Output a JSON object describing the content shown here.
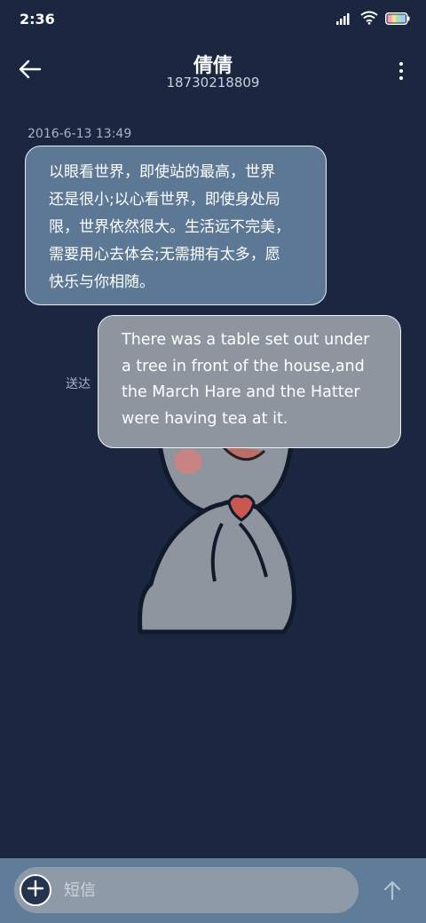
{
  "status_bar": {
    "time": "2:36",
    "icons": [
      "signal-icon",
      "wifi-icon",
      "battery-icon"
    ]
  },
  "header": {
    "back_icon": "back-arrow-icon",
    "contact_name": "倩倩",
    "phone_number": "18730218809",
    "more_icon": "more-vertical-icon"
  },
  "conversation": {
    "timestamp": "2016-6-13 13:49",
    "incoming_message": {
      "lines": [
        "以眼看世界，即使站的最高，世界",
        "还是很小;以心看世界，即使身处局",
        "限，世界依然很大。生活远不完美，",
        "需要用心去体会;无需拥有太多，愿",
        "快乐与你相随。"
      ]
    },
    "outgoing_message": {
      "status": "送达",
      "lines": [
        "There was a table set out under",
        "a tree in front of the house,and",
        "the March Hare and the Hatter",
        "were having tea at it."
      ]
    },
    "sticker_icon": "cartoon-sticker-icon"
  },
  "composer": {
    "add_icon": "plus-icon",
    "placeholder": "短信",
    "value": "",
    "send_icon": "send-arrow-icon"
  },
  "colors": {
    "background": "#1b2740",
    "incoming_bubble": "#5d7895",
    "outgoing_bubble": "#8e959f",
    "composer_bar": "#5f7d99"
  }
}
